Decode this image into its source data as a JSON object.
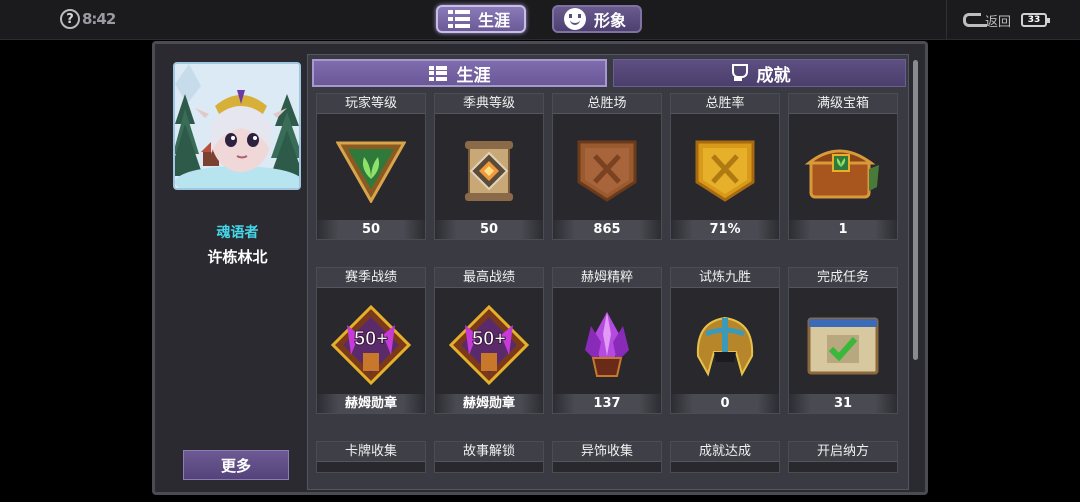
{
  "topbar": {
    "help_time": "8:42",
    "tabs": [
      {
        "label": "生涯",
        "icon": "list-icon",
        "active": true
      },
      {
        "label": "形象",
        "icon": "smile-icon",
        "active": false
      }
    ],
    "back_label": "返回",
    "battery": "33"
  },
  "profile": {
    "title": "魂语者",
    "name": "许栋林北",
    "more_label": "更多"
  },
  "subtabs": [
    {
      "label": "生涯",
      "icon": "list-icon",
      "active": true
    },
    {
      "label": "成就",
      "icon": "trophy-icon",
      "active": false
    }
  ],
  "cards": [
    {
      "header": "玩家等级",
      "value": "50",
      "icon": "level-triangle-icon"
    },
    {
      "header": "季典等级",
      "value": "50",
      "icon": "scroll-badge-icon"
    },
    {
      "header": "总胜场",
      "value": "865",
      "icon": "bronze-shield-icon"
    },
    {
      "header": "总胜率",
      "value": "71%",
      "icon": "gold-shield-icon"
    },
    {
      "header": "满级宝箱",
      "value": "1",
      "icon": "treasure-chest-icon"
    },
    {
      "header": "赛季战绩",
      "value": "赫姆勋章",
      "icon": "hem-medal-icon",
      "badge": "50+"
    },
    {
      "header": "最高战绩",
      "value": "赫姆勋章",
      "icon": "hem-medal-icon",
      "badge": "50+"
    },
    {
      "header": "赫姆精粹",
      "value": "137",
      "icon": "purple-crystal-icon"
    },
    {
      "header": "试炼九胜",
      "value": "0",
      "icon": "helmet-icon"
    },
    {
      "header": "完成任务",
      "value": "31",
      "icon": "checkmark-board-icon"
    },
    {
      "header": "卡牌收集",
      "icon": ""
    },
    {
      "header": "故事解锁",
      "icon": ""
    },
    {
      "header": "异饰收集",
      "icon": ""
    },
    {
      "header": "成就达成",
      "icon": ""
    },
    {
      "header": "开启纳方",
      "icon": ""
    }
  ]
}
